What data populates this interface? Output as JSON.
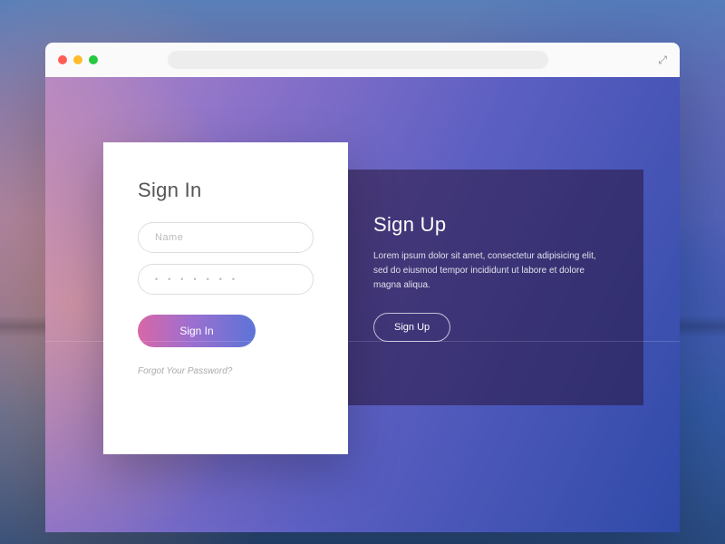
{
  "signin": {
    "title": "Sign In",
    "name_placeholder": "Name",
    "password_placeholder": "•  •  •  •  •  •  •",
    "submit_label": "Sign In",
    "forgot_label": "Forgot Your Password?"
  },
  "signup": {
    "title": "Sign Up",
    "description": "Lorem ipsum dolor sit amet, consectetur adipisicing elit, sed do eiusmod tempor incididunt ut labore et dolore magna aliqua.",
    "button_label": "Sign Up"
  }
}
